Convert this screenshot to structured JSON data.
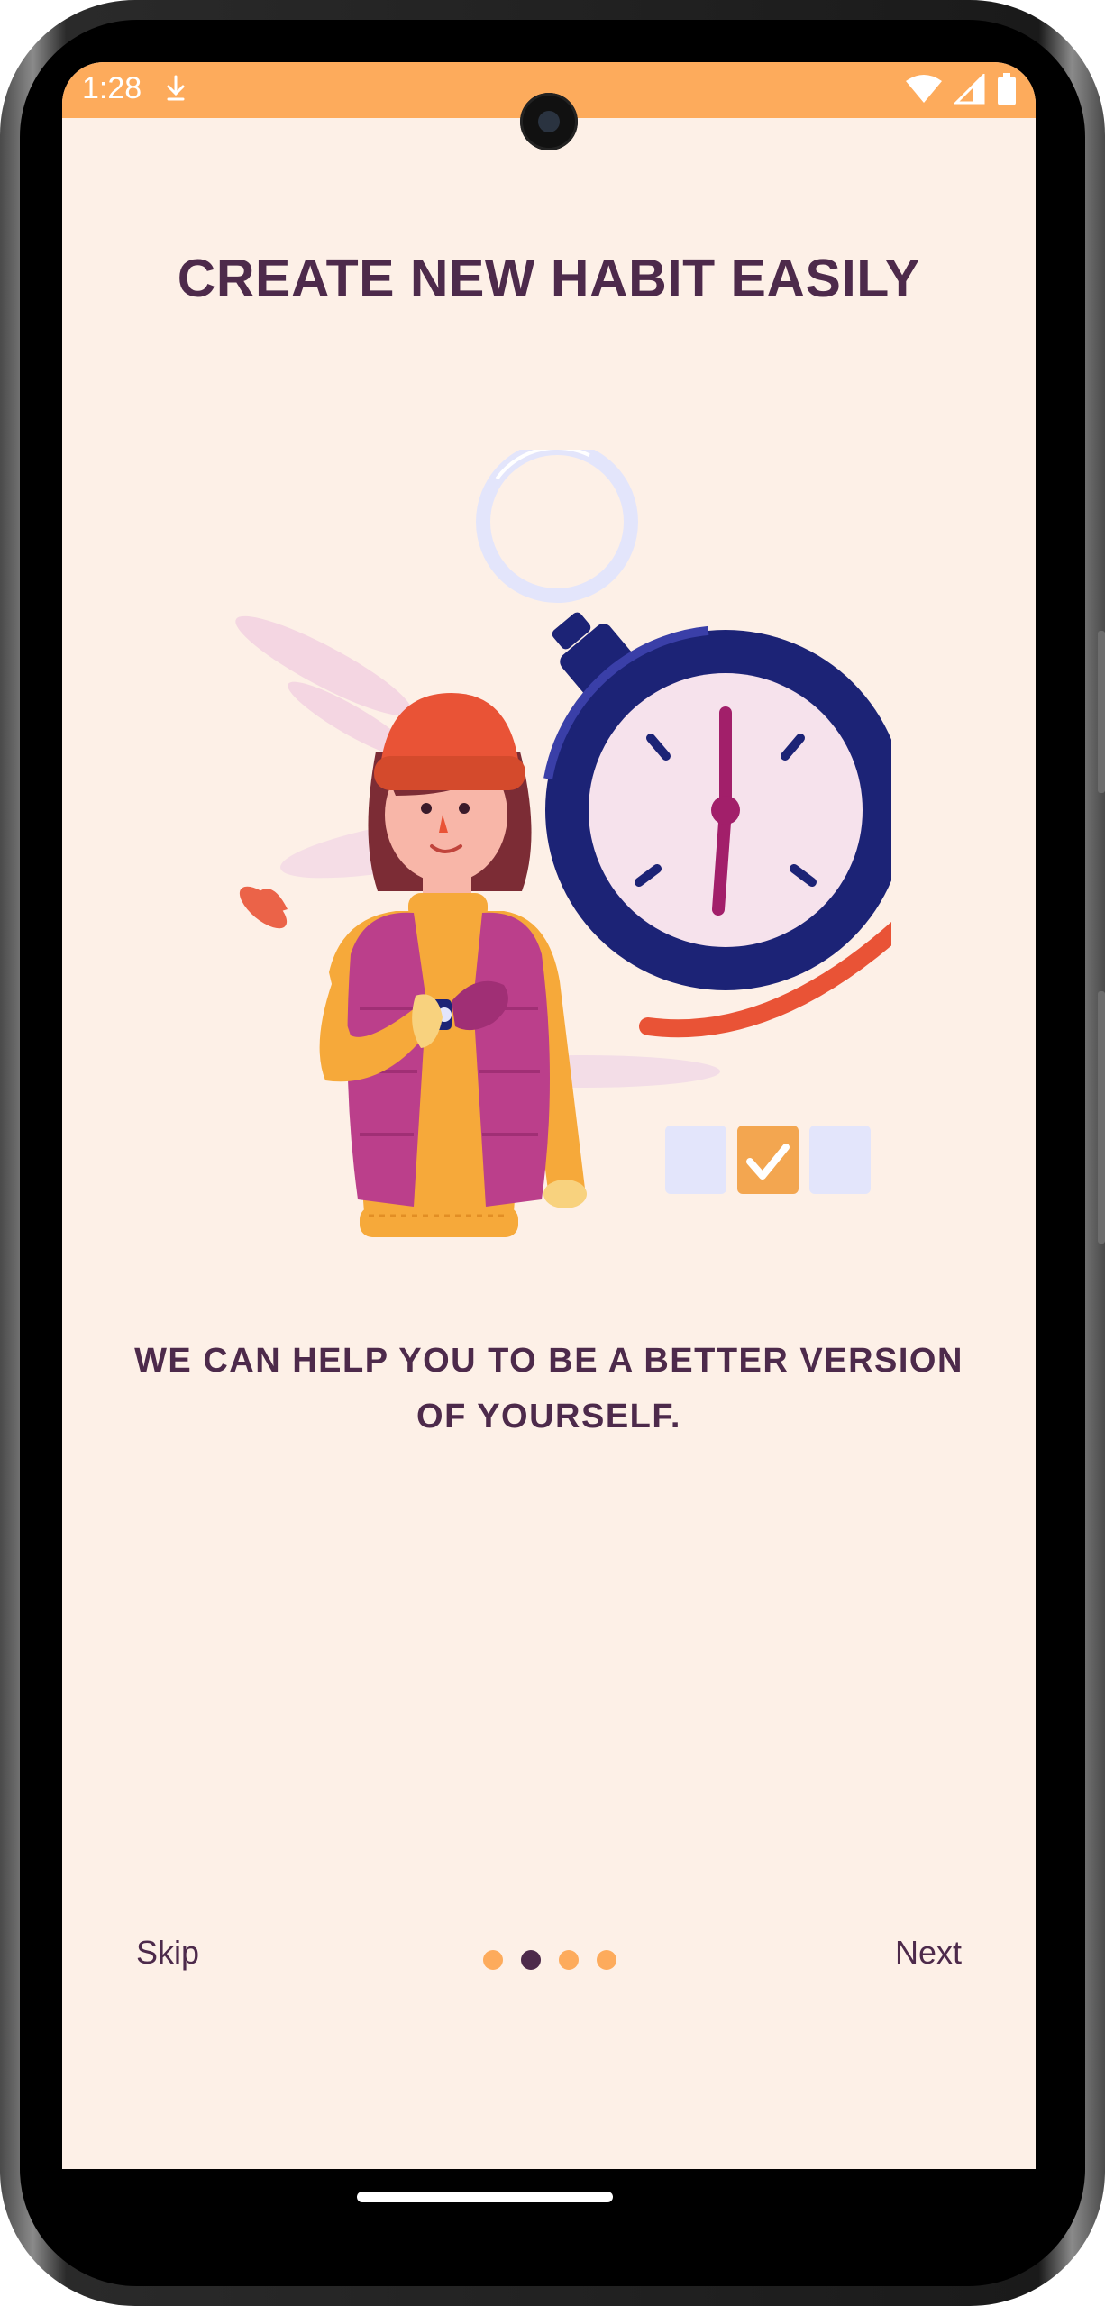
{
  "status_bar": {
    "time": "1:28"
  },
  "onboarding": {
    "title": "CREATE NEW HABIT EASILY",
    "subtitle_line1": "WE CAN HELP YOU TO BE A BETTER VERSION",
    "subtitle_line2": "OF YOURSELF.",
    "illustration": "woman-checking-watch-with-stopwatch-illustration"
  },
  "footer": {
    "skip_label": "Skip",
    "next_label": "Next",
    "page_count": 4,
    "active_page": 2
  },
  "colors": {
    "status_bar": "#fdab5c",
    "background": "#fdf0e7",
    "text": "#4d2a4b",
    "dot_inactive": "#fdab5c",
    "dot_active": "#4d2a4b"
  }
}
